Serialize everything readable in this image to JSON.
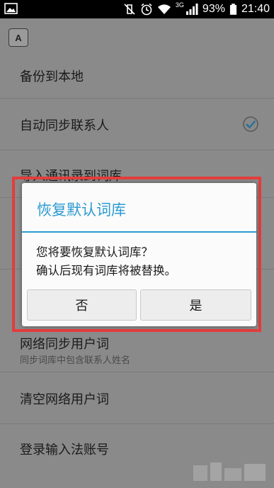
{
  "status_bar": {
    "network": "3G",
    "battery": "93%",
    "time": "21:40"
  },
  "settings": {
    "items": [
      {
        "title": "备份到本地"
      },
      {
        "title": "自动同步联系人",
        "checked": true
      },
      {
        "title": "导入通讯录到词库"
      },
      {
        "title": "网络同步用户词",
        "subtitle": "同步词库中包含联系人姓名"
      },
      {
        "title": "清空网络用户词"
      },
      {
        "title": "登录输入法账号"
      }
    ]
  },
  "dialog": {
    "title": "恢复默认词库",
    "message_line1": "您将要恢复默认词库？",
    "message_line2": "确认后现有词库将被替换。",
    "cancel_label": "否",
    "confirm_label": "是"
  },
  "colors": {
    "accent": "#2b9bd1",
    "highlight_frame": "#e43c3c"
  }
}
